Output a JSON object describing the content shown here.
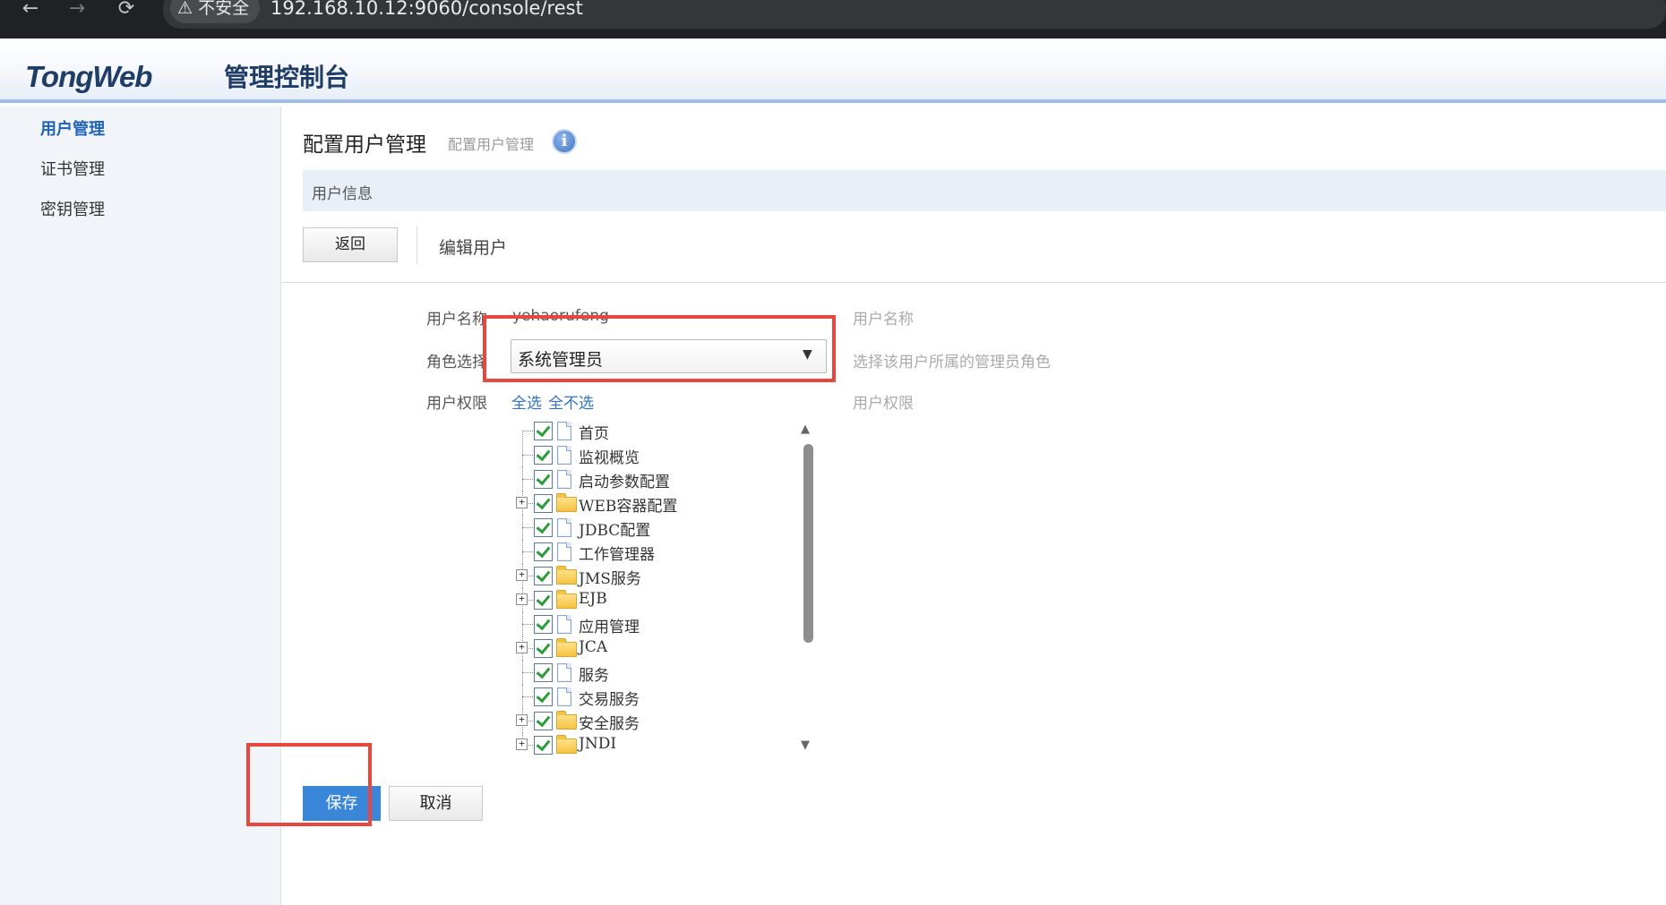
{
  "browser": {
    "back_icon": "←",
    "forward_icon": "→",
    "reload_icon": "⟳",
    "security_label": "不安全",
    "url": "192.168.10.12:9060/console/rest"
  },
  "header": {
    "logo_text": "TongWeb",
    "logo_subtitle": "管理控制台"
  },
  "sidebar": {
    "items": [
      {
        "label": "用户管理",
        "active": true
      },
      {
        "label": "证书管理",
        "active": false
      },
      {
        "label": "密钥管理",
        "active": false
      }
    ]
  },
  "main": {
    "title": "配置用户管理",
    "subtitle": "配置用户管理",
    "info_icon": "i",
    "section_title": "用户信息",
    "back_label": "返回",
    "edit_title": "编辑用户"
  },
  "form": {
    "username": {
      "label": "用户名称",
      "value": "yehaorufeng",
      "help": "用户名称"
    },
    "role": {
      "label": "角色选择",
      "value": "系统管理员",
      "help": "选择该用户所属的管理员角色"
    },
    "permissions": {
      "label": "用户权限",
      "select_all": "全选",
      "select_none": "全不选",
      "help": "用户权限"
    }
  },
  "tree": {
    "items": [
      {
        "label": "首页",
        "type": "doc",
        "expandable": false,
        "checked": true
      },
      {
        "label": "监视概览",
        "type": "doc",
        "expandable": false,
        "checked": true
      },
      {
        "label": "启动参数配置",
        "type": "doc",
        "expandable": false,
        "checked": true
      },
      {
        "label": "WEB容器配置",
        "type": "folder",
        "expandable": true,
        "checked": true
      },
      {
        "label": "JDBC配置",
        "type": "doc",
        "expandable": false,
        "checked": true
      },
      {
        "label": "工作管理器",
        "type": "doc",
        "expandable": false,
        "checked": true
      },
      {
        "label": "JMS服务",
        "type": "folder",
        "expandable": true,
        "checked": true
      },
      {
        "label": "EJB",
        "type": "folder",
        "expandable": true,
        "checked": true
      },
      {
        "label": "应用管理",
        "type": "doc",
        "expandable": false,
        "checked": true
      },
      {
        "label": "JCA",
        "type": "folder",
        "expandable": true,
        "checked": true
      },
      {
        "label": "服务",
        "type": "doc",
        "expandable": false,
        "checked": true
      },
      {
        "label": "交易服务",
        "type": "doc",
        "expandable": false,
        "checked": true
      },
      {
        "label": "安全服务",
        "type": "folder",
        "expandable": true,
        "checked": true
      },
      {
        "label": "JNDI",
        "type": "folder",
        "expandable": true,
        "checked": true
      }
    ]
  },
  "actions": {
    "save_label": "保存",
    "cancel_label": "取消"
  },
  "colors": {
    "accent": "#3a87d9",
    "link": "#2f73c9",
    "highlight": "#e8473f"
  }
}
